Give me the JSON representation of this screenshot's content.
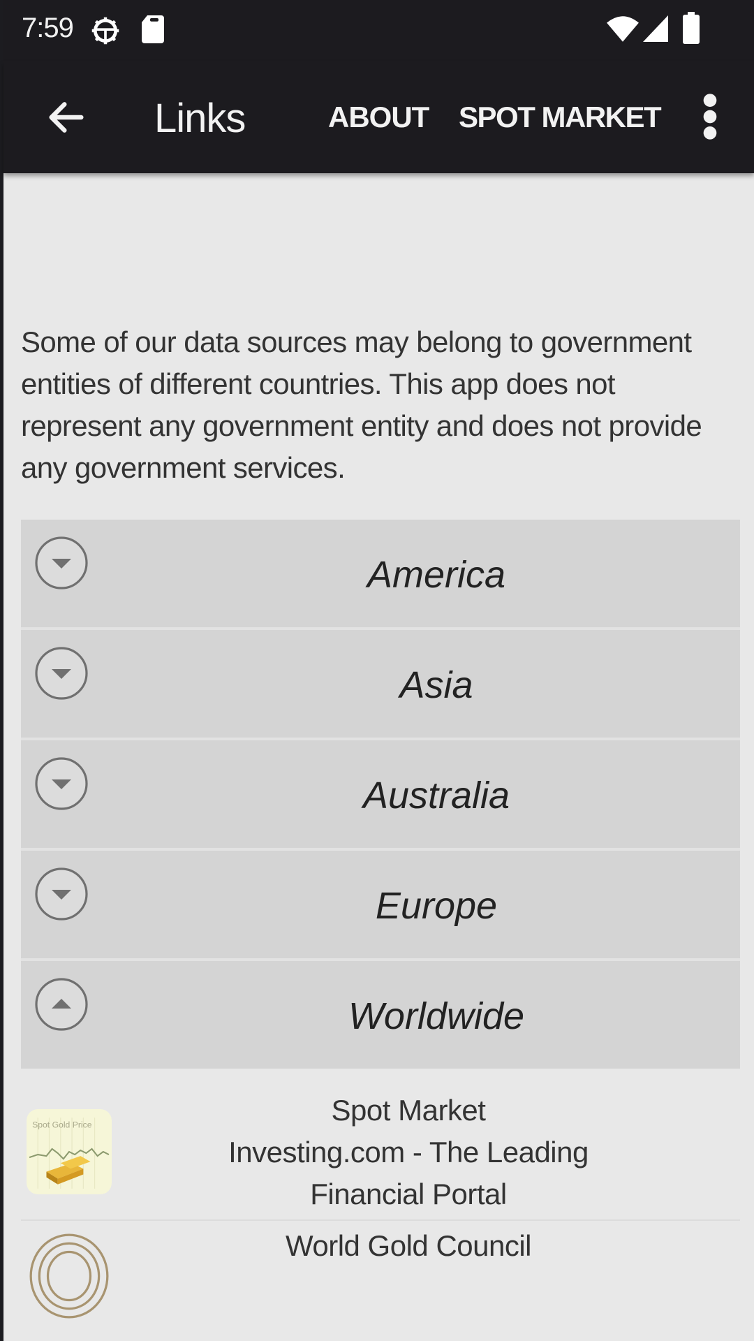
{
  "status_bar": {
    "time": "7:59",
    "icons": [
      "settings-gear-icon",
      "sd-card-icon",
      "wifi-icon",
      "cell-signal-icon",
      "battery-icon"
    ]
  },
  "app_bar": {
    "title": "Links",
    "back_icon": "arrow-back-icon",
    "actions": [
      {
        "label": "ABOUT"
      },
      {
        "label": "SPOT MARKET"
      }
    ],
    "overflow_icon": "more-vert-icon"
  },
  "disclaimer": "Some of our data sources may belong to government entities of different countries. This app does not represent any government entity and does not provide any government services.",
  "regions": [
    {
      "label": "America",
      "expanded": false,
      "icon": "expand-down-icon"
    },
    {
      "label": "Asia",
      "expanded": false,
      "icon": "expand-down-icon"
    },
    {
      "label": "Australia",
      "expanded": false,
      "icon": "expand-down-icon"
    },
    {
      "label": "Europe",
      "expanded": false,
      "icon": "expand-down-icon"
    },
    {
      "label": "Worldwide",
      "expanded": true,
      "icon": "collapse-up-icon"
    }
  ],
  "links": [
    {
      "lines": [
        "Spot Market",
        "Investing.com - The Leading",
        "Financial Portal"
      ],
      "thumb_caption": "Spot Gold Price",
      "icon": "gold-bars-chart-icon"
    },
    {
      "lines": [
        "World Gold Council"
      ],
      "icon": "world-gold-council-logo-icon"
    }
  ],
  "colors": {
    "app_bar": "#1c1b1f",
    "background": "#e8e8e8",
    "accordion_row": "#d4d4d4",
    "gold": "#a89470"
  }
}
